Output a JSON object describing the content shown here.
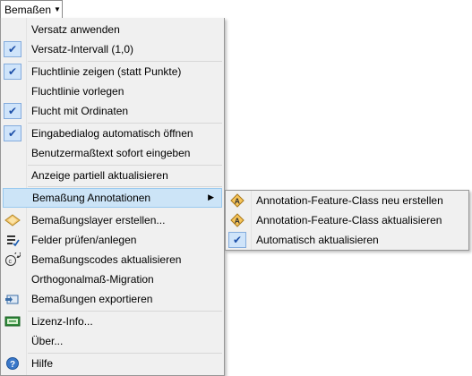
{
  "menubar": {
    "title": "Bemaßen"
  },
  "menu": {
    "items": [
      {
        "label": "Versatz anwenden",
        "checked": false,
        "icon": ""
      },
      {
        "label": "Versatz-Intervall (1,0)",
        "checked": true,
        "icon": "check-icon"
      },
      {
        "label": "Fluchtlinie zeigen (statt Punkte)",
        "checked": true,
        "icon": "check-icon"
      },
      {
        "label": "Fluchtlinie vorlegen",
        "checked": false,
        "icon": ""
      },
      {
        "label": "Flucht mit Ordinaten",
        "checked": true,
        "icon": "check-icon"
      },
      {
        "label": "Eingabedialog automatisch öffnen",
        "checked": true,
        "icon": "check-icon"
      },
      {
        "label": "Benutzermaßtext sofort eingeben",
        "checked": false,
        "icon": ""
      },
      {
        "label": "Anzeige partiell aktualisieren",
        "checked": false,
        "icon": ""
      },
      {
        "label": "Bemaßung Annotationen",
        "checked": false,
        "icon": "",
        "submenu": true,
        "highlighted": true
      },
      {
        "label": "Bemaßungslayer erstellen...",
        "icon": "layer-diamond-icon"
      },
      {
        "label": "Felder prüfen/anlegen",
        "icon": "fields-check-icon"
      },
      {
        "label": "Bemaßungscodes aktualisieren",
        "icon": "copyright-refresh-icon"
      },
      {
        "label": "Orthogonalmaß-Migration",
        "icon": ""
      },
      {
        "label": "Bemaßungen exportieren",
        "icon": "export-icon"
      },
      {
        "label": "Lizenz-Info...",
        "icon": "license-icon"
      },
      {
        "label": "Über...",
        "icon": ""
      },
      {
        "label": "Hilfe",
        "icon": "help-icon"
      }
    ]
  },
  "submenu": {
    "items": [
      {
        "label": "Annotation-Feature-Class neu erstellen",
        "icon": "annotation-icon"
      },
      {
        "label": "Annotation-Feature-Class aktualisieren",
        "icon": "annotation-icon"
      },
      {
        "label": "Automatisch aktualisieren",
        "checked": true,
        "icon": "check-icon"
      }
    ]
  },
  "colors": {
    "menu_bg": "#f0f0f0",
    "highlight_bg": "#cce4f7",
    "highlight_border": "#99c9ef",
    "check_bg": "#cfe4fa",
    "check_color": "#1d4fa8"
  }
}
